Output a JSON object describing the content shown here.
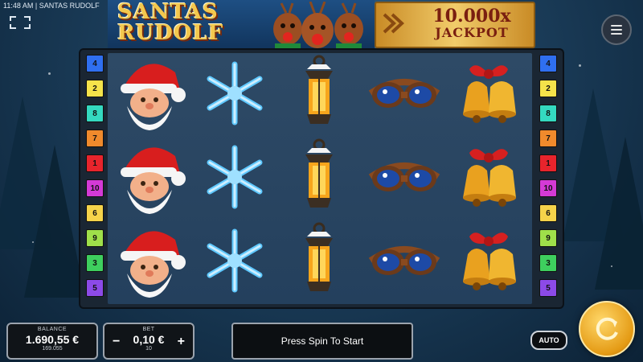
{
  "status_bar": {
    "time": "11:48 AM",
    "separator": "|",
    "game_name": "SANTAS RUDOLF"
  },
  "logo": {
    "line1": "SANTAS",
    "line2": "RUDOLF"
  },
  "jackpot": {
    "amount": "10.000x",
    "label": "JACKPOT"
  },
  "reels": [
    {
      "symbol": "santa",
      "cells": [
        "santa",
        "santa",
        "santa"
      ]
    },
    {
      "symbol": "snowflake",
      "cells": [
        "snowflake",
        "snowflake",
        "snowflake"
      ]
    },
    {
      "symbol": "lantern",
      "cells": [
        "lantern",
        "lantern",
        "lantern"
      ]
    },
    {
      "symbol": "goggles",
      "cells": [
        "goggles",
        "goggles",
        "goggles"
      ]
    },
    {
      "symbol": "bells",
      "cells": [
        "bells",
        "bells",
        "bells"
      ]
    }
  ],
  "paylines": [
    {
      "number": "4",
      "color": "#2f6ff0"
    },
    {
      "number": "2",
      "color": "#f5e34a"
    },
    {
      "number": "8",
      "color": "#34d9c0"
    },
    {
      "number": "7",
      "color": "#f08a2c"
    },
    {
      "number": "1",
      "color": "#e8242c"
    },
    {
      "number": "10",
      "color": "#d43ad6"
    },
    {
      "number": "6",
      "color": "#f5d34a"
    },
    {
      "number": "9",
      "color": "#9fe04a"
    },
    {
      "number": "3",
      "color": "#3ecf5e"
    },
    {
      "number": "5",
      "color": "#8c4ae8"
    }
  ],
  "balance": {
    "label": "BALANCE",
    "value": "1.690,55 €",
    "sub": "169.055"
  },
  "bet": {
    "label": "BET",
    "value": "0,10 €",
    "sub": "10",
    "minus": "−",
    "plus": "+"
  },
  "message": "Press Spin To Start",
  "auto_label": "AUTO",
  "icons": [
    "fullscreen-icon",
    "menu-icon",
    "spin-icon"
  ],
  "colors": {
    "accent": "#f1b52a",
    "frame": "#1a2633",
    "panel_border": "#9ba3ad"
  }
}
